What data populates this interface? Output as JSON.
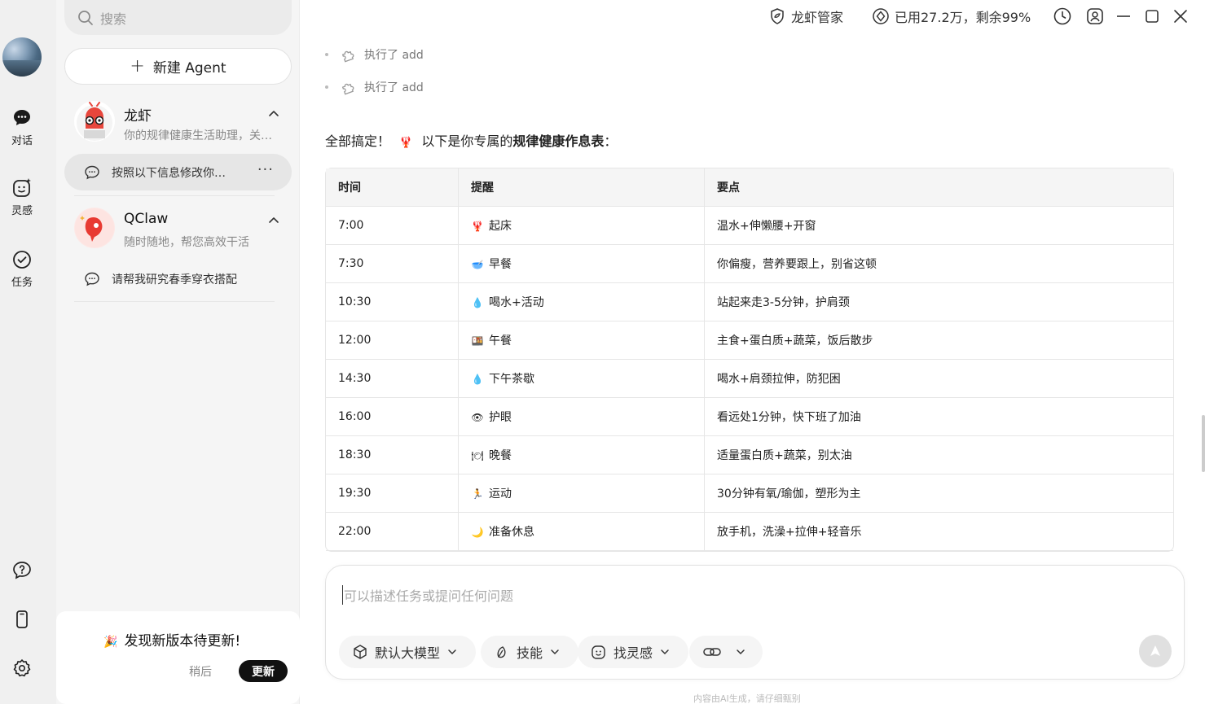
{
  "rail": {
    "items": [
      {
        "label": "对话",
        "icon": "chat-bubble-icon"
      },
      {
        "label": "灵感",
        "icon": "smile-spark-icon"
      },
      {
        "label": "任务",
        "icon": "check-circle-icon"
      }
    ],
    "bottom_icons": [
      "help-icon",
      "phone-icon",
      "settings-icon"
    ]
  },
  "sidebar": {
    "search_placeholder": "搜索",
    "new_agent_label": "新建 Agent",
    "agents": [
      {
        "name": "龙虾",
        "desc": "你的规律健康生活助理，关…",
        "chat": "按照以下信息修改你…"
      },
      {
        "name": "QClaw",
        "desc": "随时随地，帮您高效干活",
        "chat": "请帮我研究春季穿衣搭配"
      }
    ],
    "update": {
      "title": "发现新版本待更新!",
      "later": "稍后",
      "update": "更新"
    }
  },
  "topbar": {
    "manager": "龙虾管家",
    "usage": "已用27.2万，剩余99%"
  },
  "main": {
    "steps": [
      "执行了 add",
      "执行了 add"
    ],
    "intro_prefix": "全部搞定！",
    "intro_middle": "以下是你专属的",
    "intro_bold": "规律健康作息表",
    "intro_suffix": "：",
    "table": {
      "headers": [
        "时间",
        "提醒",
        "要点"
      ],
      "rows": [
        {
          "time": "7:00",
          "emoji": "🦞",
          "remind": "起床",
          "point": "温水+伸懒腰+开窗"
        },
        {
          "time": "7:30",
          "emoji": "🥣",
          "remind": "早餐",
          "point": "你偏瘦，营养要跟上，别省这顿"
        },
        {
          "time": "10:30",
          "emoji": "💧",
          "remind": "喝水+活动",
          "point": "站起来走3-5分钟，护肩颈"
        },
        {
          "time": "12:00",
          "emoji": "🍱",
          "remind": "午餐",
          "point": "主食+蛋白质+蔬菜，饭后散步"
        },
        {
          "time": "14:30",
          "emoji": "💧",
          "remind": "下午茶歇",
          "point": "喝水+肩颈拉伸，防犯困"
        },
        {
          "time": "16:00",
          "emoji": "👁",
          "remind": "护眼",
          "point": "看远处1分钟，快下班了加油"
        },
        {
          "time": "18:30",
          "emoji": "🍽",
          "remind": "晚餐",
          "point": "适量蛋白质+蔬菜，别太油"
        },
        {
          "time": "19:30",
          "emoji": "🏃",
          "remind": "运动",
          "point": "30分钟有氧/瑜伽，塑形为主"
        },
        {
          "time": "22:00",
          "emoji": "🌙",
          "remind": "准备休息",
          "point": "放手机，洗澡+拉伸+轻音乐"
        }
      ]
    }
  },
  "composer": {
    "placeholder": "可以描述任务或提问任何问题",
    "model": "默认大模型",
    "skill": "技能",
    "inspire": "找灵感"
  },
  "footnote": "内容由AI生成，请仔细甄别"
}
